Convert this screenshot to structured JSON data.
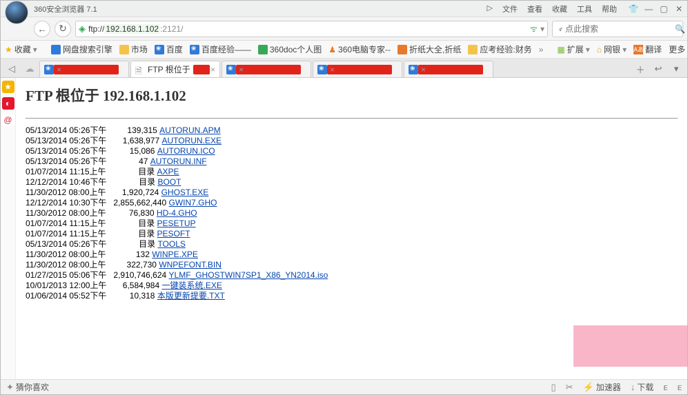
{
  "titlebar": {
    "title": "360安全浏览器 7.1"
  },
  "menu": {
    "file": "文件",
    "view": "查看",
    "fav": "收藏",
    "tools": "工具",
    "help": "帮助"
  },
  "addr": {
    "scheme": "ftp://",
    "host": "192.168.1.102",
    "port": ":2121/"
  },
  "search": {
    "placeholder": "点此搜索"
  },
  "bookmarks": {
    "fav": "收藏",
    "netdisk": "网盘搜索引擎",
    "market": "市场",
    "baidu": "百度",
    "bdexp": "百度经验——",
    "doc360": "360doc个人图",
    "pcexpert": "360电脑专家--",
    "zhezhi": "折纸大全,折纸",
    "yingkao": "应考经验:财务",
    "ext": "扩展",
    "bank": "网银",
    "trans": "翻译",
    "more": "更多"
  },
  "tabs": {
    "ftp_label": "FTP 根位于 1"
  },
  "page": {
    "heading": "FTP 根位于 192.168.1.102"
  },
  "listing": [
    {
      "dt": "05/13/2014 05:26下午",
      "size": "139,315",
      "name": "AUTORUN.APM"
    },
    {
      "dt": "05/13/2014 05:26下午",
      "size": "1,638,977",
      "name": "AUTORUN.EXE"
    },
    {
      "dt": "05/13/2014 05:26下午",
      "size": "15,086",
      "name": "AUTORUN.ICO"
    },
    {
      "dt": "05/13/2014 05:26下午",
      "size": "47",
      "name": "AUTORUN.INF"
    },
    {
      "dt": "01/07/2014 11:15上午",
      "size": "目录",
      "name": "AXPE"
    },
    {
      "dt": "12/12/2014 10:46下午",
      "size": "目录",
      "name": "BOOT"
    },
    {
      "dt": "11/30/2012 08:00上午",
      "size": "1,920,724",
      "name": "GHOST.EXE"
    },
    {
      "dt": "12/12/2014 10:30下午",
      "size": "2,855,662,440",
      "name": "GWIN7.GHO"
    },
    {
      "dt": "11/30/2012 08:00上午",
      "size": "76,830",
      "name": "HD-4.GHO"
    },
    {
      "dt": "01/07/2014 11:15上午",
      "size": "目录",
      "name": "PESETUP"
    },
    {
      "dt": "01/07/2014 11:15上午",
      "size": "目录",
      "name": "PESOFT"
    },
    {
      "dt": "05/13/2014 05:26下午",
      "size": "目录",
      "name": "TOOLS"
    },
    {
      "dt": "11/30/2012 08:00上午",
      "size": "132",
      "name": "WINPE.XPE"
    },
    {
      "dt": "11/30/2012 08:00上午",
      "size": "322,730",
      "name": "WNPEFONT.BIN"
    },
    {
      "dt": "01/27/2015 05:06下午",
      "size": "2,910,746,624",
      "name": "YLMF_GHOSTWIN7SP1_X86_YN2014.iso"
    },
    {
      "dt": "10/01/2013 12:00上午",
      "size": "6,584,984",
      "name": "一键装系统.EXE"
    },
    {
      "dt": "01/06/2014 05:52下午",
      "size": "10,318",
      "name": "本版更新提要.TXT"
    }
  ],
  "status": {
    "guess": "猜你喜欢",
    "accel": "加速器",
    "dl": "下载"
  }
}
